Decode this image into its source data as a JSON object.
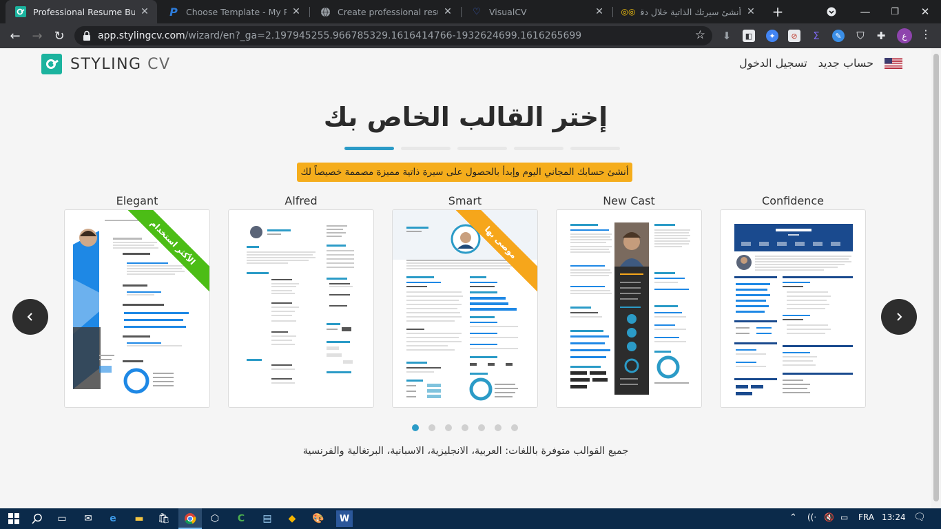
{
  "browser": {
    "tabs": [
      {
        "title": "Professional Resume Builder",
        "favicon": "stylingcv-icon",
        "active": true
      },
      {
        "title": "Choose Template - My Perfect",
        "favicon": "p-icon",
        "active": false
      },
      {
        "title": "Create professional resumes",
        "favicon": "globe-icon",
        "active": false
      },
      {
        "title": "VisualCV",
        "favicon": "visualcv-icon",
        "active": false
      },
      {
        "title": "أنشئ سيرتك الذاتية خلال دقيقتـ",
        "favicon": "glasses-icon",
        "active": false
      }
    ],
    "url_host": "app.stylingcv.com",
    "url_path": "/wizard/en?_ga=2.197945255.966785329.1616414766-1932624699.1616265699",
    "profile_initial": "ع"
  },
  "site": {
    "logo_text_1": "STYLING",
    "logo_text_2": " CV",
    "nav": {
      "new_account": "حساب جديد",
      "login": "تسجيل الدخول"
    }
  },
  "wizard": {
    "title": "إختر القالب الخاص بك",
    "banner": "أنشئ حسابك المجاني اليوم وإبدأ بالحصول على سيرة ذاتية مميزة مصممة خصيصاً لك",
    "templates": [
      {
        "name": "Elegant",
        "ribbon": "الأكثر استخدام",
        "ribbon_color": "#4cbd16"
      },
      {
        "name": "Alfred",
        "ribbon": "",
        "ribbon_color": ""
      },
      {
        "name": "Smart",
        "ribbon": "موصى بها",
        "ribbon_color": "#f6a61b"
      },
      {
        "name": "New Cast",
        "ribbon": "",
        "ribbon_color": ""
      },
      {
        "name": "Confidence",
        "ribbon": "",
        "ribbon_color": ""
      }
    ],
    "preview_labels": {
      "elegant_name": "Steve Johns",
      "alfred_name": "Steve Johns",
      "smart_name": "Steve Johns",
      "confidence_name": "STEVE JOHNS"
    },
    "footer_note": "جميع القوالب متوفرة باللغات: العربية، الانجليزية، الاسبانية، البرتغالية والفرنسية"
  },
  "taskbar": {
    "language": "FRA",
    "time": "13:24"
  },
  "colors": {
    "accent": "#2b9bc7",
    "brand": "#1bb39e",
    "banner": "#f5ad1c"
  }
}
